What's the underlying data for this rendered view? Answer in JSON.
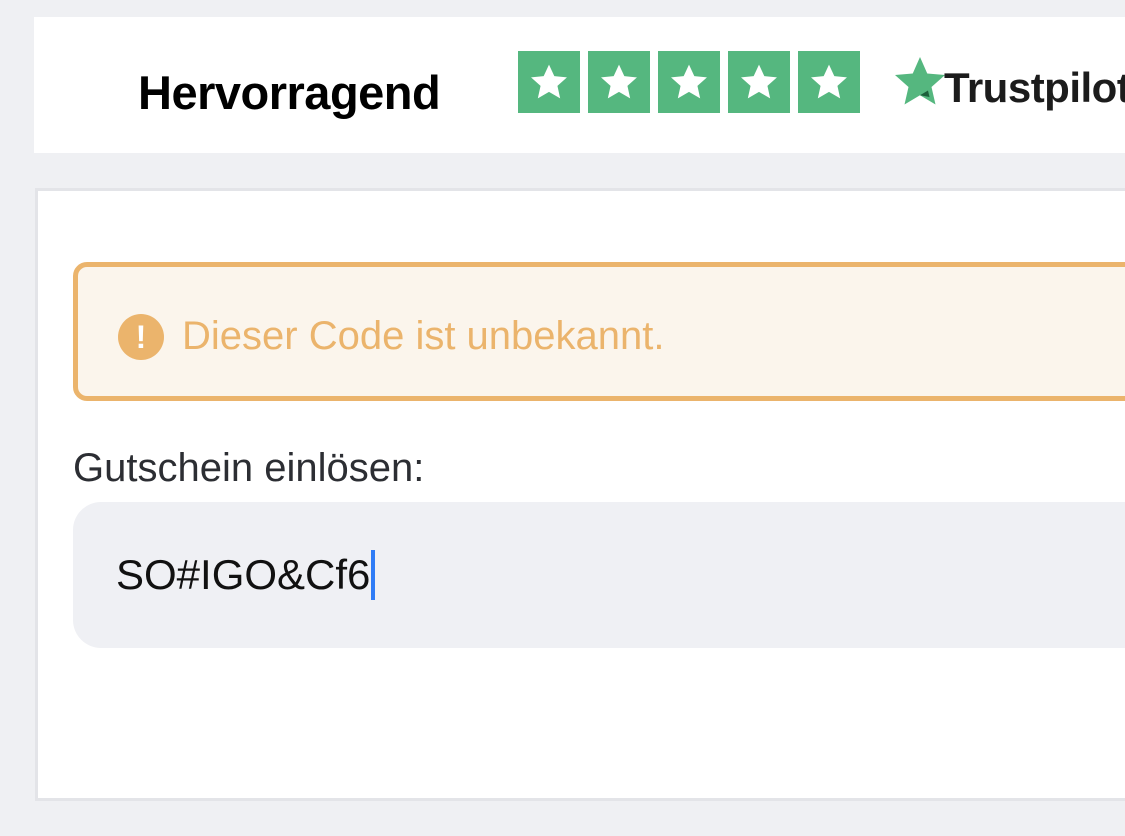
{
  "trustpilot": {
    "rating_label": "Hervorragend",
    "stars": [
      1,
      1,
      1,
      1,
      1
    ],
    "star_color": "#55b77f",
    "logo_star_color": "#55b77f",
    "brand_name": "Trustpilot"
  },
  "alert": {
    "icon": "exclamation-circle-icon",
    "icon_glyph": "!",
    "message": "Dieser Code ist unbekannt.",
    "color": "#ebb46c",
    "background": "#fbf5ec"
  },
  "voucher": {
    "label": "Gutschein einlösen:",
    "value": "SO#IGO&Cf6",
    "caret_color": "#2f7cf6"
  }
}
